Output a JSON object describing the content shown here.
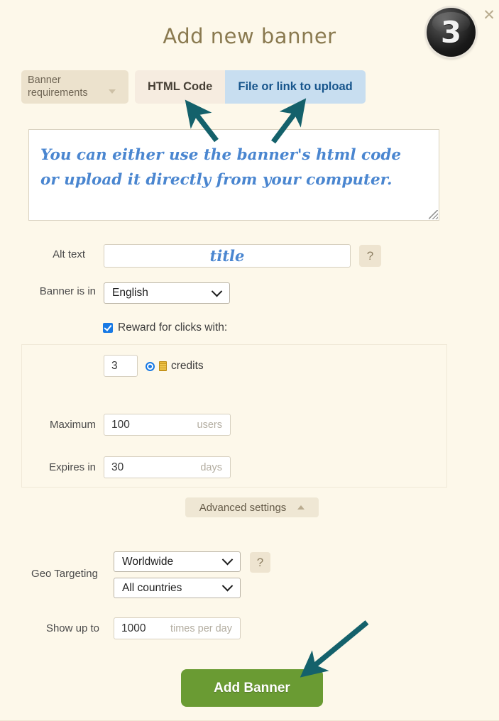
{
  "dialog": {
    "title": "Add new banner",
    "step_badge": "3",
    "close_icon": "close-icon",
    "accent_title_color": "#8a7a50",
    "background_color": "#fdf8ea",
    "annotation_arrow_color": "#14616b"
  },
  "toolbar": {
    "requirements_button": "Banner requirements",
    "requirements_caret_icon": "caret-down-icon",
    "tabs": [
      {
        "label": "HTML Code",
        "active": false
      },
      {
        "label": "File or link to upload",
        "active": true
      }
    ]
  },
  "code_area": {
    "value": "You can either use the banner's html code\nor upload it directly from your computer.",
    "resize_handle_icon": "resize-grip-icon",
    "text_color": "#4a86d0"
  },
  "fields": {
    "alt_text": {
      "label": "Alt text",
      "value": "title",
      "help_icon": "question-mark-icon",
      "help_label": "?"
    },
    "banner_language": {
      "label": "Banner is in",
      "value": "English",
      "chevron_icon": "chevron-down-icon"
    },
    "reward_checkbox": {
      "label": "Reward for clicks with:",
      "checked": true,
      "check_icon": "checkmark-icon"
    },
    "credits": {
      "amount": "3",
      "radio_selected": true,
      "coin_icon": "credits-coin-icon",
      "unit_label": "credits"
    },
    "maximum": {
      "label": "Maximum",
      "value": "100",
      "suffix": "users"
    },
    "expires_in": {
      "label": "Expires in",
      "value": "30",
      "suffix": "days"
    },
    "advanced_settings": {
      "label": "Advanced settings",
      "caret_icon": "caret-up-icon"
    },
    "geo_targeting": {
      "label": "Geo Targeting",
      "scope_value": "Worldwide",
      "countries_value": "All countries",
      "chevron_icon": "chevron-down-icon",
      "help_label": "?"
    },
    "show_up_to": {
      "label": "Show up to",
      "value": "1000",
      "suffix": "times per day"
    }
  },
  "submit": {
    "label": "Add Banner",
    "color": "#6a9b33"
  }
}
